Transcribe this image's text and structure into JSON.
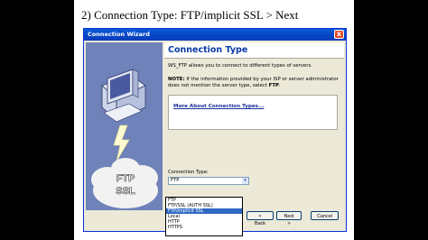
{
  "slide": {
    "heading": "2) Connection Type: FTP/implicit SSL > Next"
  },
  "window": {
    "title": "Connection Wizard",
    "close_label": "x"
  },
  "art": {
    "cloud_label_line1": "FTP",
    "cloud_label_line2": "SSL"
  },
  "content": {
    "title": "Connection Type",
    "intro": "WS_FTP allows you to connect to different types of servers.",
    "note_bold": "NOTE:",
    "note_text": " If the information provided by your ISP or server administrator does not mention the server type, select ",
    "note_ftp": "FTP",
    "note_end": ".",
    "more_link": "More About Connection Types..."
  },
  "connection_type": {
    "label": "Connection Type:",
    "selected": "FTP",
    "arrow": "▾",
    "options": [
      "FTP",
      "FTP/SSL (AUTH SSL)",
      "FTP/implicit SSL",
      "Local",
      "HTTP",
      "HTTPS"
    ],
    "highlighted_option": "FTP/implicit SSL"
  },
  "buttons": {
    "back": "< Back",
    "next": "Next >",
    "cancel": "Cancel"
  },
  "colors": {
    "title_bar": "#0a5ad8",
    "art_panel": "#6f82b9",
    "heading_text": "#0a3aa5",
    "selection": "#316ac5"
  }
}
